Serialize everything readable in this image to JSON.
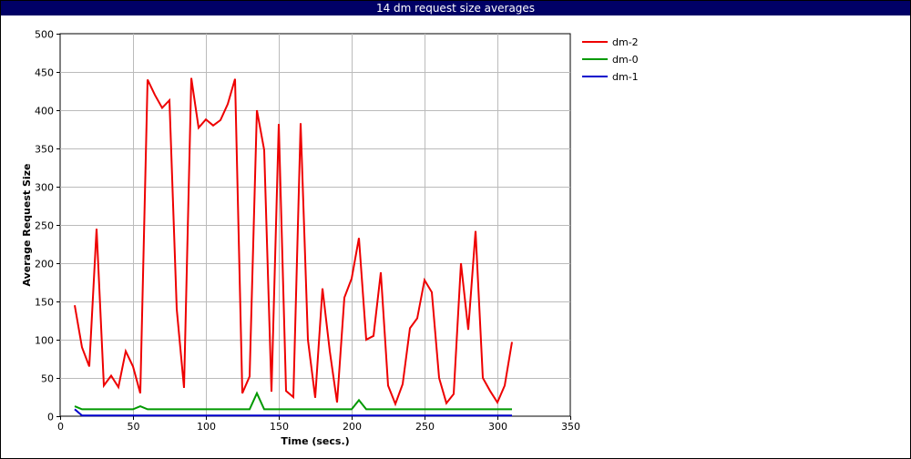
{
  "chart_data": {
    "type": "line",
    "title": "14 dm request size averages",
    "xlabel": "Time (secs.)",
    "ylabel": "Average Request Size",
    "xlim": [
      0,
      350
    ],
    "ylim": [
      0,
      500
    ],
    "xticks": [
      0,
      50,
      100,
      150,
      200,
      250,
      300,
      350
    ],
    "yticks": [
      0,
      50,
      100,
      150,
      200,
      250,
      300,
      350,
      400,
      450,
      500
    ],
    "grid": true,
    "legend_position": "top-right",
    "series": [
      {
        "name": "dm-2",
        "color": "#ee0000",
        "points": [
          [
            10,
            145
          ],
          [
            15,
            90
          ],
          [
            20,
            65
          ],
          [
            25,
            245
          ],
          [
            30,
            40
          ],
          [
            35,
            53
          ],
          [
            40,
            38
          ],
          [
            45,
            85
          ],
          [
            50,
            65
          ],
          [
            55,
            30
          ],
          [
            60,
            440
          ],
          [
            65,
            420
          ],
          [
            70,
            403
          ],
          [
            75,
            413
          ],
          [
            80,
            140
          ],
          [
            85,
            37
          ],
          [
            90,
            442
          ],
          [
            95,
            377
          ],
          [
            100,
            388
          ],
          [
            105,
            380
          ],
          [
            110,
            387
          ],
          [
            115,
            408
          ],
          [
            120,
            441
          ],
          [
            125,
            30
          ],
          [
            130,
            52
          ],
          [
            135,
            400
          ],
          [
            140,
            348
          ],
          [
            145,
            32
          ],
          [
            150,
            382
          ],
          [
            155,
            33
          ],
          [
            160,
            25
          ],
          [
            165,
            383
          ],
          [
            170,
            100
          ],
          [
            175,
            24
          ],
          [
            180,
            167
          ],
          [
            185,
            85
          ],
          [
            190,
            18
          ],
          [
            195,
            155
          ],
          [
            200,
            180
          ],
          [
            205,
            233
          ],
          [
            210,
            100
          ],
          [
            215,
            105
          ],
          [
            220,
            188
          ],
          [
            225,
            40
          ],
          [
            230,
            16
          ],
          [
            235,
            42
          ],
          [
            240,
            115
          ],
          [
            245,
            128
          ],
          [
            250,
            178
          ],
          [
            255,
            162
          ],
          [
            260,
            50
          ],
          [
            265,
            17
          ],
          [
            270,
            29
          ],
          [
            275,
            200
          ],
          [
            280,
            113
          ],
          [
            285,
            242
          ],
          [
            290,
            50
          ],
          [
            295,
            33
          ],
          [
            300,
            18
          ],
          [
            305,
            40
          ],
          [
            310,
            97
          ]
        ]
      },
      {
        "name": "dm-0",
        "color": "#009900",
        "points": [
          [
            10,
            13
          ],
          [
            15,
            9
          ],
          [
            50,
            9
          ],
          [
            55,
            13
          ],
          [
            60,
            9
          ],
          [
            130,
            9
          ],
          [
            135,
            30
          ],
          [
            140,
            9
          ],
          [
            200,
            9
          ],
          [
            205,
            21
          ],
          [
            210,
            9
          ],
          [
            310,
            9
          ]
        ]
      },
      {
        "name": "dm-1",
        "color": "#0000cc",
        "points": [
          [
            10,
            9
          ],
          [
            15,
            1
          ],
          [
            20,
            1
          ],
          [
            310,
            1
          ]
        ]
      }
    ]
  }
}
